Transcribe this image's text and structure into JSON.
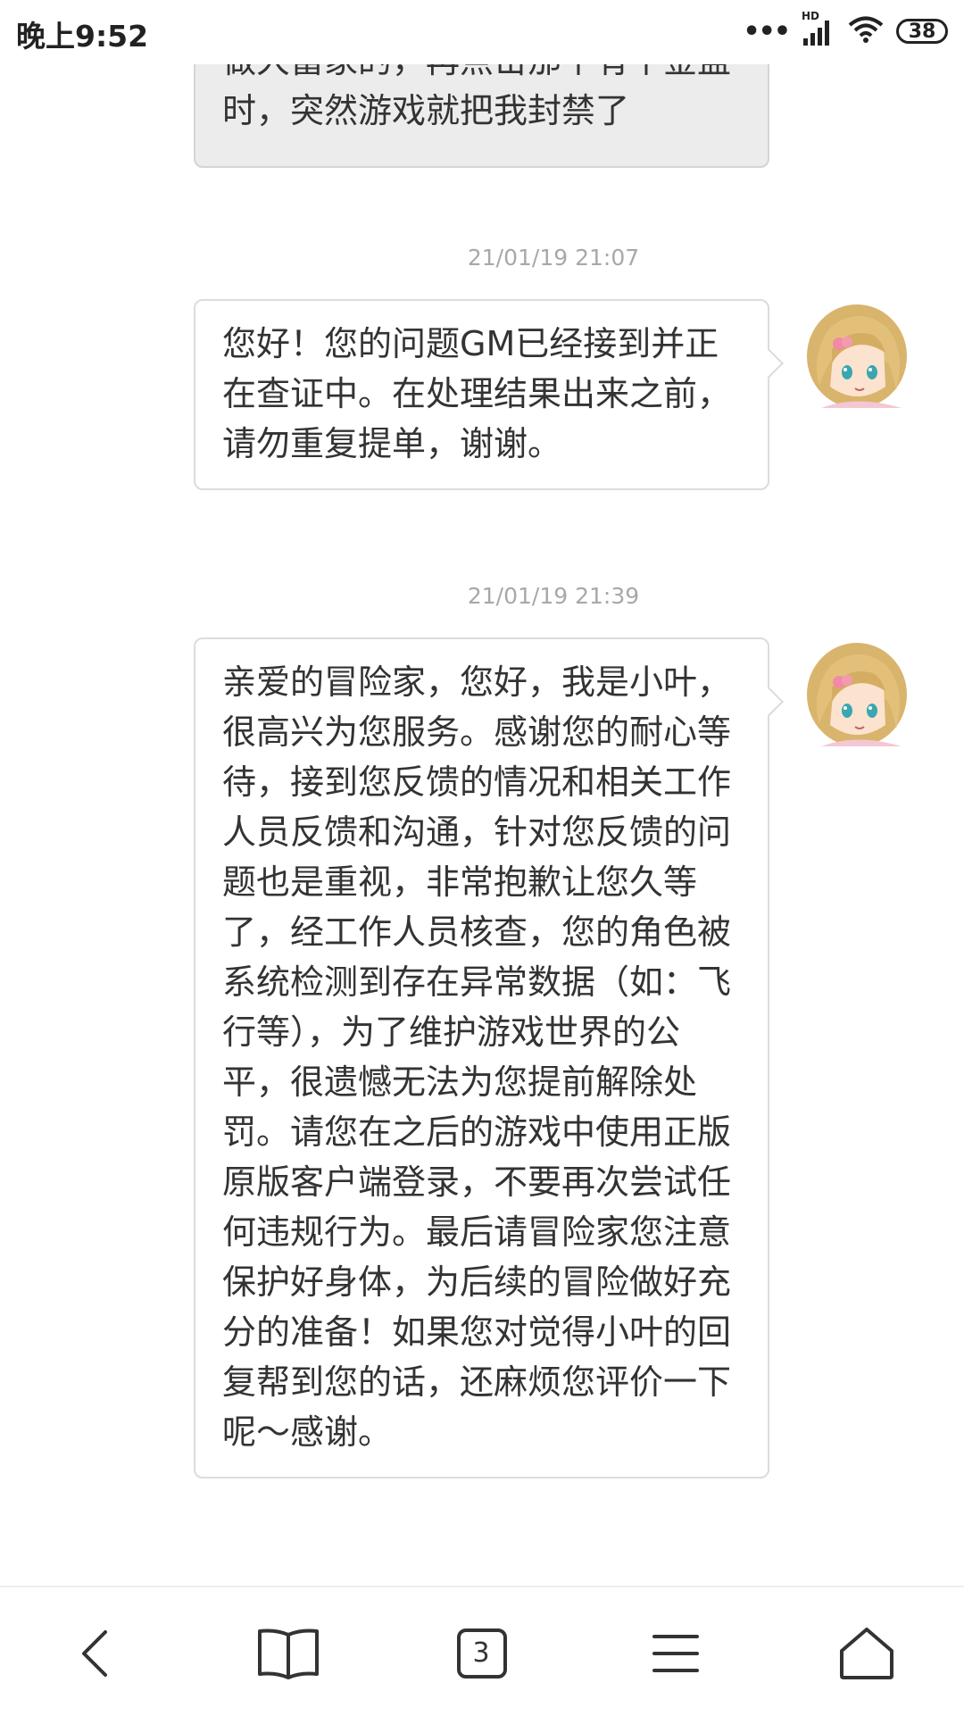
{
  "status_bar": {
    "time": "晚上9:52",
    "signal_badge": "HD",
    "battery": "38"
  },
  "messages": [
    {
      "type": "user",
      "text": "做大富家的，再点击那个有个金盆时，突然游戏就把我封禁了"
    },
    {
      "type": "reply",
      "timestamp": "21/01/19 21:07",
      "text": "您好！您的问题GM已经接到并正在查证中。在处理结果出来之前，请勿重复提单，谢谢。"
    },
    {
      "type": "reply",
      "timestamp": "21/01/19 21:39",
      "text": "亲爱的冒险家，您好，我是小叶，很高兴为您服务。感谢您的耐心等待，接到您反馈的情况和相关工作人员反馈和沟通，针对您反馈的问题也是重视，非常抱歉让您久等了，经工作人员核查，您的角色被系统检测到存在异常数据（如：飞行等），为了维护游戏世界的公平，很遗憾无法为您提前解除处罚。请您在之后的游戏中使用正版原版客户端登录，不要再次尝试任何违规行为。最后请冒险家您注意保护好身体，为后续的冒险做好充分的准备！如果您对觉得小叶的回复帮到您的话，还麻烦您评价一下呢～感谢。"
    }
  ],
  "bottom_nav": {
    "tab_count": "3",
    "icons": [
      "back-icon",
      "bookmarks-icon",
      "tabs-icon",
      "menu-icon",
      "home-icon"
    ]
  },
  "colors": {
    "user_bubble": "#ececec",
    "reply_bubble": "#ffffff",
    "bubble_border": "#dcdcdc",
    "timestamp": "#a8a8a8"
  }
}
